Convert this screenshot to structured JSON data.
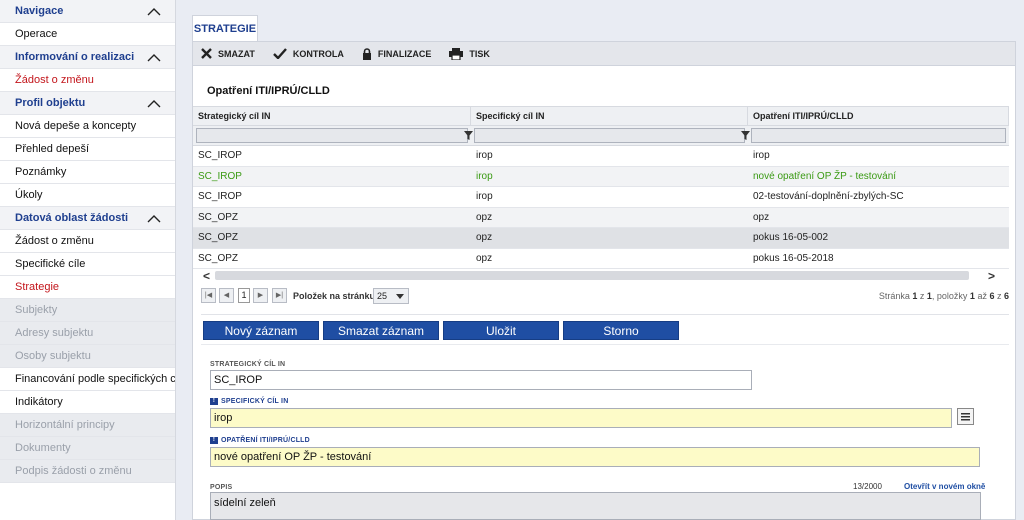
{
  "sidebar": {
    "items": [
      {
        "label": "Navigace",
        "type": "section"
      },
      {
        "label": "Operace",
        "type": "normal"
      },
      {
        "label": "Informování o realizaci",
        "type": "section"
      },
      {
        "label": "Žádost o změnu",
        "type": "red"
      },
      {
        "label": "Profil objektu",
        "type": "section"
      },
      {
        "label": "Nová depeše a koncepty",
        "type": "normal"
      },
      {
        "label": "Přehled depeší",
        "type": "normal"
      },
      {
        "label": "Poznámky",
        "type": "normal"
      },
      {
        "label": "Úkoly",
        "type": "normal"
      },
      {
        "label": "Datová oblast žádosti",
        "type": "section"
      },
      {
        "label": "Žádost o změnu",
        "type": "normal"
      },
      {
        "label": "Specifické cíle",
        "type": "normal"
      },
      {
        "label": "Strategie",
        "type": "red"
      },
      {
        "label": "Subjekty",
        "type": "disabled"
      },
      {
        "label": "Adresy subjektu",
        "type": "disabled"
      },
      {
        "label": "Osoby subjektu",
        "type": "disabled"
      },
      {
        "label": "Financování podle specifických cílů",
        "type": "normal"
      },
      {
        "label": "Indikátory",
        "type": "normal"
      },
      {
        "label": "Horizontální principy",
        "type": "disabled"
      },
      {
        "label": "Dokumenty",
        "type": "disabled"
      },
      {
        "label": "Podpis žádosti o změnu",
        "type": "disabled"
      }
    ]
  },
  "tab": {
    "label": "STRATEGIE"
  },
  "toolbar": {
    "delete": "SMAZAT",
    "check": "KONTROLA",
    "finalize": "FINALIZACE",
    "print": "TISK"
  },
  "grid": {
    "title": "Opatření ITI/IPRÚ/CLLD",
    "columns": [
      "Strategický cíl IN",
      "Specifický cíl IN",
      "Opatření ITI/IPRÚ/CLLD"
    ],
    "rows": [
      [
        "SC_IROP",
        "irop",
        "irop"
      ],
      [
        "SC_IROP",
        "irop",
        "nové opatření OP ŽP - testování"
      ],
      [
        "SC_IROP",
        "irop",
        "02-testování-doplnění-zbylých-SC"
      ],
      [
        "SC_OPZ",
        "opz",
        "opz"
      ],
      [
        "SC_OPZ",
        "opz",
        "pokus 16-05-002"
      ],
      [
        "SC_OPZ",
        "opz",
        "pokus 16-05-2018"
      ]
    ],
    "selected_row": 1
  },
  "pager": {
    "current_page": "1",
    "per_page_label": "Položek na stránku",
    "per_page": "25",
    "info_prefix": "Stránka ",
    "info_page": "1",
    "info_mid1": " z ",
    "info_pages": "1",
    "info_mid2": ", položky ",
    "info_from": "1",
    "info_mid3": " až ",
    "info_to": "6",
    "info_mid4": " z ",
    "info_total": "6"
  },
  "actions": {
    "new": "Nový záznam",
    "delete": "Smazat záznam",
    "save": "Uložit",
    "cancel": "Storno"
  },
  "form": {
    "strategic_label": "STRATEGICKÝ CÍL IN",
    "strategic_value": "SC_IROP",
    "specific_label": "SPECIFICKÝ CÍL IN",
    "specific_value": "irop",
    "measure_label": "OPATŘENÍ ITI/IPRÚ/CLLD",
    "measure_value": "nové opatření OP ŽP - testování",
    "description_label": "POPIS",
    "description_value": "sídelní zeleň",
    "counter": "13/2000",
    "open_new_window": "Otevřít v novém okně"
  },
  "colors": {
    "accent": "#1f4ea3",
    "section_text": "#1f3f8f",
    "active_red": "#c3161c",
    "selected_green": "#3a9a13",
    "required_bg": "#fdfbc8"
  }
}
